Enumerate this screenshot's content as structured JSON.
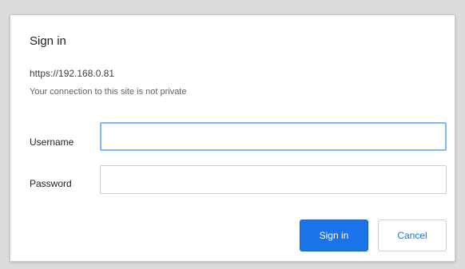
{
  "dialog": {
    "title": "Sign in",
    "origin": "https://192.168.0.81",
    "privacy_note": "Your connection to this site is not private",
    "username_label": "Username",
    "username_value": "",
    "password_label": "Password",
    "password_value": "",
    "sign_in_button": "Sign in",
    "cancel_button": "Cancel"
  },
  "colors": {
    "primary": "#1a73e8",
    "focus_ring": "#8ab4f8"
  }
}
